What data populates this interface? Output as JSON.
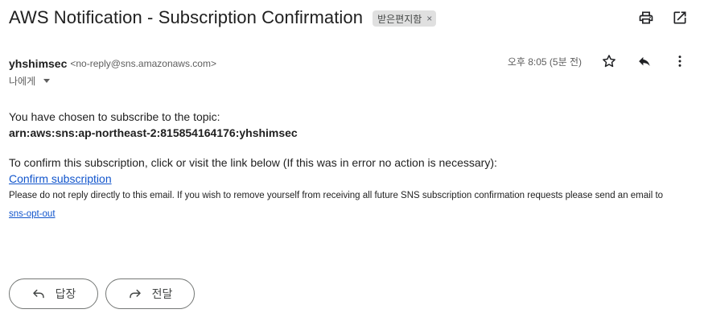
{
  "email": {
    "subject": "AWS Notification - Subscription Confirmation",
    "label_chip": "받은편지함",
    "label_remove": "×",
    "sender_name": "yhshimsec",
    "sender_email": "<no-reply@sns.amazonaws.com>",
    "timestamp": "오후 8:05 (5분 전)",
    "recipient": "나에게",
    "body": {
      "line1": "You have chosen to subscribe to the topic:",
      "topic_arn": "arn:aws:sns:ap-northeast-2:815854164176:yhshimsec",
      "line2": "To confirm this subscription, click or visit the link below (If this was in error no action is necessary):",
      "confirm_link": "Confirm subscription",
      "footer_text": "Please do not reply directly to this email. If you wish to remove yourself from receiving all future SNS subscription confirmation requests please send an email to",
      "opt_out_link": "sns-opt-out"
    }
  },
  "actions": {
    "reply_label": "답장",
    "forward_label": "전달"
  },
  "icons": {
    "print": "print-icon",
    "open_new_window": "open-in-new-window-icon",
    "star": "star-icon",
    "reply": "reply-icon",
    "more": "more-vert-icon",
    "forward": "forward-icon"
  }
}
